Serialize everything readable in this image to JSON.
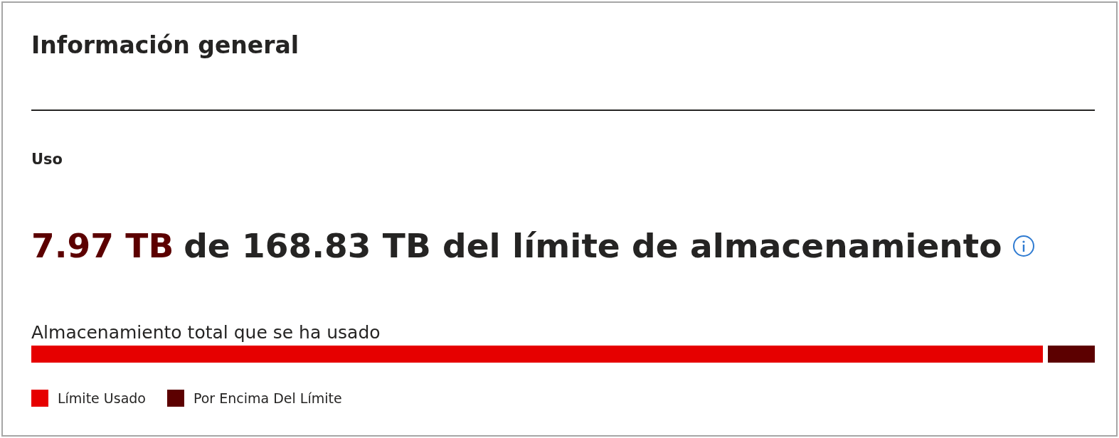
{
  "title": "Información general",
  "section": "Uso",
  "usage": {
    "amount": "7.97 TB",
    "rest": "de 168.83 TB del límite de almacenamiento"
  },
  "bar": {
    "label": "Almacenamiento total que se ha usado",
    "segments": [
      {
        "label": "Límite Usado",
        "color": "#e60000"
      },
      {
        "label": "Por Encima Del Límite",
        "color": "#5c0000"
      }
    ]
  }
}
